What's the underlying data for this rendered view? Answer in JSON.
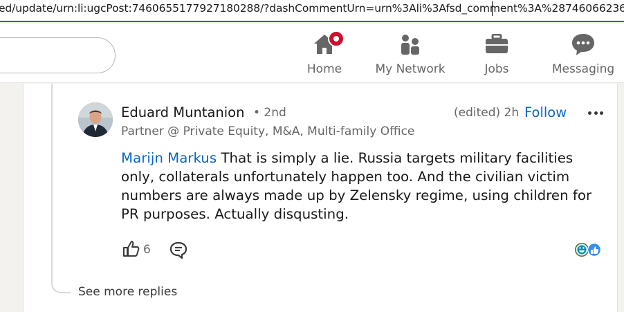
{
  "browser": {
    "url": "ed/update/urn:li:ugcPost:7460655177927180288/?dashCommentUrn=urn%3Ali%3Afsd_comment%3A%287460662364"
  },
  "nav": {
    "items": [
      {
        "label": "Home",
        "icon": "home-icon",
        "notification": true
      },
      {
        "label": "My Network",
        "icon": "network-icon"
      },
      {
        "label": "Jobs",
        "icon": "briefcase-icon"
      },
      {
        "label": "Messaging",
        "icon": "messaging-icon"
      }
    ]
  },
  "comment": {
    "author": "Eduard Muntanion",
    "degree": "• 2nd",
    "headline": "Partner @ Private Equity, M&A, Multi-family Office",
    "meta": "(edited) 2h",
    "follow_label": "Follow",
    "mention": "Marijn Markus",
    "text": " That is simply a lie. Russia targets military facilities only, collaterals unfortunately happen too. And the civilian victim numbers are always made up by Zelensky regime, using children for PR purposes. Actually disqusting.",
    "like_count": "6",
    "reaction_icons": [
      "funny-icon",
      "like-icon"
    ]
  },
  "thread": {
    "see_more_label": "See more replies"
  },
  "colors": {
    "brand_blue": "#0a66c2",
    "notification_red": "#cb112d"
  }
}
